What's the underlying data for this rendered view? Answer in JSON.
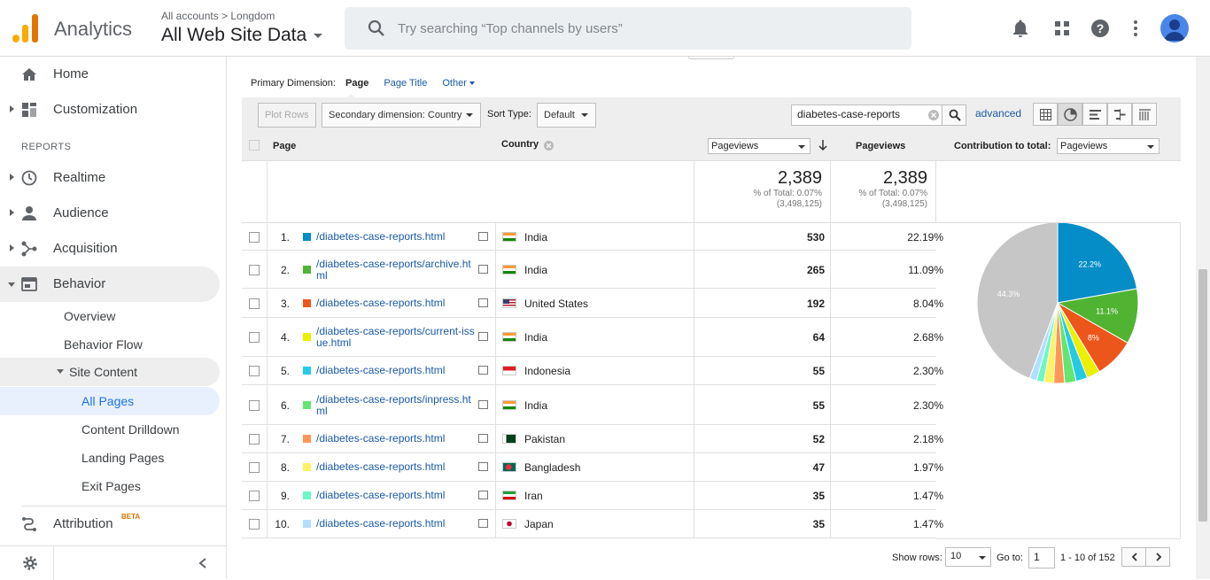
{
  "topbar": {
    "app_name": "Analytics",
    "breadcrumb": "All accounts > Longdom",
    "property": "All Web Site Data",
    "search_placeholder": "Try searching “Top channels by users”"
  },
  "sidebar": {
    "home": "Home",
    "customization": "Customization",
    "reports_label": "REPORTS",
    "realtime": "Realtime",
    "audience": "Audience",
    "acquisition": "Acquisition",
    "behavior": "Behavior",
    "overview": "Overview",
    "behavior_flow": "Behavior Flow",
    "site_content": "Site Content",
    "all_pages": "All Pages",
    "content_drilldown": "Content Drilldown",
    "landing_pages": "Landing Pages",
    "exit_pages": "Exit Pages",
    "attribution": "Attribution",
    "beta": "BETA"
  },
  "primary_dimension": {
    "label": "Primary Dimension:",
    "page": "Page",
    "page_title": "Page Title",
    "other": "Other"
  },
  "toolbar": {
    "plot_rows": "Plot Rows",
    "secondary_dimension": "Secondary dimension: Country",
    "sort_type_label": "Sort Type:",
    "sort_type": "Default",
    "filter_value": "diabetes-case-reports",
    "advanced": "advanced"
  },
  "table": {
    "col_page": "Page",
    "col_country": "Country",
    "metric_select": "Pageviews",
    "col_pageviews": "Pageviews",
    "contribution_label": "Contribution to total:",
    "contribution_select": "Pageviews",
    "totals": {
      "pv1": "2,389",
      "pct1": "% of Total: 0.07%",
      "abs1": "(3,498,125)",
      "pv2": "2,389",
      "pct2": "% of Total: 0.07%",
      "abs2": "(3,498,125)"
    },
    "rows": [
      {
        "num": "1.",
        "page": "/diabetes-case-reports.html",
        "country": "India",
        "pv": "530",
        "pct": "22.19%",
        "color": "#058dc7"
      },
      {
        "num": "2.",
        "page": "/diabetes-case-reports/archive.html",
        "country": "India",
        "pv": "265",
        "pct": "11.09%",
        "color": "#50b432"
      },
      {
        "num": "3.",
        "page": "/diabetes-case-reports.html",
        "country": "United States",
        "pv": "192",
        "pct": "8.04%",
        "color": "#ed561b"
      },
      {
        "num": "4.",
        "page": "/diabetes-case-reports/current-issue.html",
        "country": "India",
        "pv": "64",
        "pct": "2.68%",
        "color": "#edef00"
      },
      {
        "num": "5.",
        "page": "/diabetes-case-reports.html",
        "country": "Indonesia",
        "pv": "55",
        "pct": "2.30%",
        "color": "#24cbe5"
      },
      {
        "num": "6.",
        "page": "/diabetes-case-reports/inpress.html",
        "country": "India",
        "pv": "55",
        "pct": "2.30%",
        "color": "#64e572"
      },
      {
        "num": "7.",
        "page": "/diabetes-case-reports.html",
        "country": "Pakistan",
        "pv": "52",
        "pct": "2.18%",
        "color": "#ff9655"
      },
      {
        "num": "8.",
        "page": "/diabetes-case-reports.html",
        "country": "Bangladesh",
        "pv": "47",
        "pct": "1.97%",
        "color": "#fff263"
      },
      {
        "num": "9.",
        "page": "/diabetes-case-reports.html",
        "country": "Iran",
        "pv": "35",
        "pct": "1.47%",
        "color": "#6af9c4"
      },
      {
        "num": "10.",
        "page": "/diabetes-case-reports.html",
        "country": "Japan",
        "pv": "35",
        "pct": "1.47%",
        "color": "#b2deff"
      }
    ]
  },
  "pie_labels": {
    "s1": "22.2%",
    "s2": "11.1%",
    "s3": "8%",
    "other": "44.3%"
  },
  "chart_data": {
    "type": "pie",
    "categories": [
      "1",
      "2",
      "3",
      "4",
      "5",
      "6",
      "7",
      "8",
      "9",
      "10",
      "Other"
    ],
    "values": [
      22.19,
      11.09,
      8.04,
      2.68,
      2.3,
      2.3,
      2.18,
      1.97,
      1.47,
      1.47,
      44.31
    ],
    "colors": [
      "#058dc7",
      "#50b432",
      "#ed561b",
      "#edef00",
      "#24cbe5",
      "#64e572",
      "#ff9655",
      "#fff263",
      "#6af9c4",
      "#b2deff",
      "#c6c6c6"
    ]
  },
  "pager": {
    "show_rows_label": "Show rows:",
    "show_rows": "10",
    "goto_label": "Go to:",
    "goto_value": "1",
    "range": "1 - 10 of 152"
  }
}
